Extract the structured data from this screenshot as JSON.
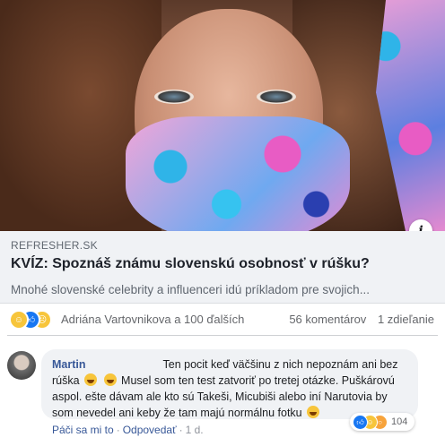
{
  "post": {
    "info_icon": "info-icon",
    "link": {
      "domain": "REFRESHER.SK",
      "title": "KVÍZ: Spoznáš známu slovenskú osobnosť v rúšku?",
      "description": "Mnohé slovenské celebrity a influenceri idú príkladom pre svojich..."
    },
    "reactions": {
      "icons": [
        "haha-icon",
        "like-icon",
        "sad-icon"
      ],
      "names": "Adriána Vartovnikova a 100 ďalších",
      "comments": "56 komentárov",
      "shares": "1 zdieľanie"
    }
  },
  "comment": {
    "author": "Martin",
    "text_1": "Ten pocit keď väčšinu z nich nepoznám ani bez rúška",
    "text_2": "Musel som ten test zatvoriť po tretej otázke. Puškárovú aspol. ešte dávam ale kto sú Takeši, Micubiši alebo iní Narutovia by som nevedel ani keby že tam majú normálnu fotku",
    "reactions": {
      "icons": [
        "like-icon",
        "haha-icon",
        "wow-icon"
      ],
      "count": "104"
    },
    "actions": {
      "like": "Páči sa mi to",
      "reply": "Odpovedať",
      "time": "1 d."
    }
  },
  "colors": {
    "link_blue": "#385898",
    "card_gray": "#f0f2f5",
    "meta_gray": "#65676b"
  }
}
